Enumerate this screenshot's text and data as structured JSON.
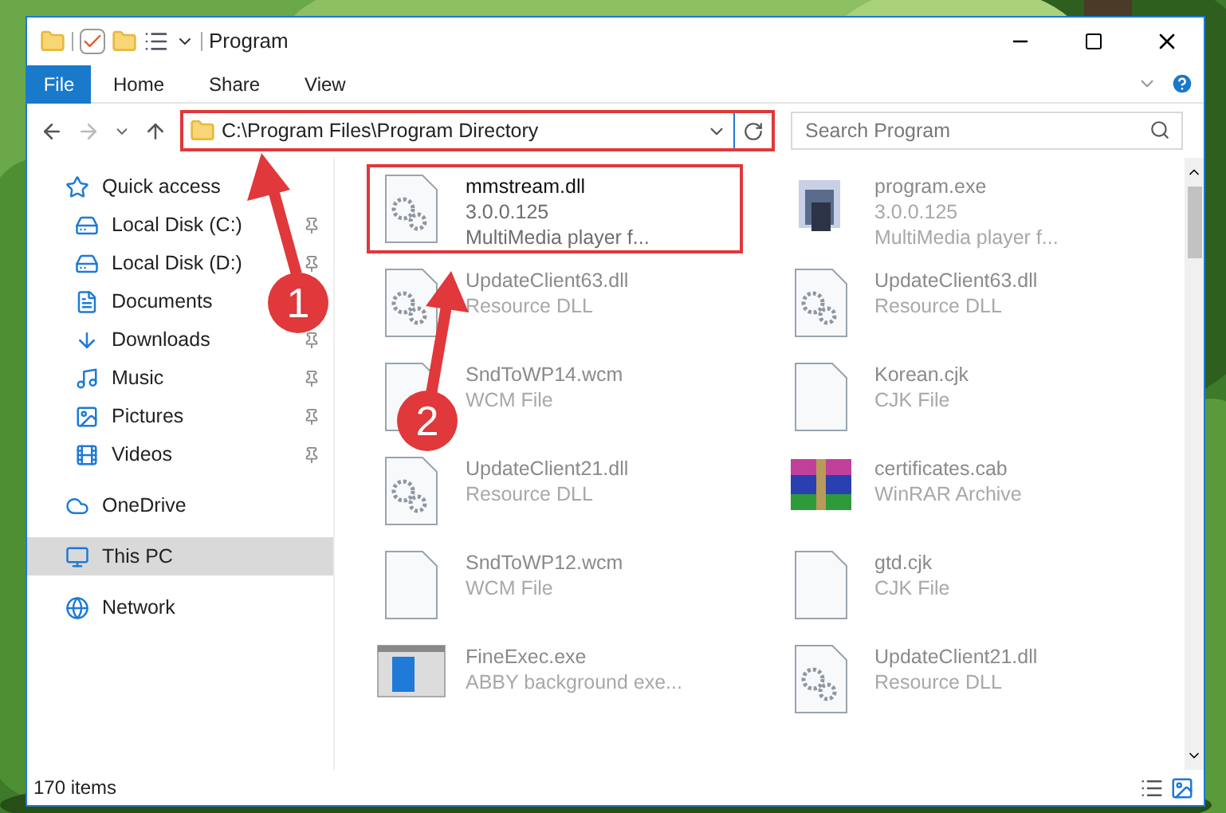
{
  "window": {
    "title": "Program"
  },
  "ribbon": {
    "tabs": [
      {
        "label": "File",
        "kind": "file"
      },
      {
        "label": "Home",
        "kind": "tab"
      },
      {
        "label": "Share",
        "kind": "tab"
      },
      {
        "label": "View",
        "kind": "tab"
      }
    ]
  },
  "address": {
    "path": "C:\\Program Files\\Program Directory",
    "highlighted": true
  },
  "search": {
    "placeholder": "Search Program"
  },
  "sidebar": {
    "items": [
      {
        "label": "Quick access",
        "selected": false,
        "children": [
          {
            "label": "Local Disk (C:)",
            "pinned": true
          },
          {
            "label": "Local Disk (D:)",
            "pinned": true
          },
          {
            "label": "Documents"
          },
          {
            "label": "Downloads",
            "pinned": true
          },
          {
            "label": "Music",
            "pinned": true
          },
          {
            "label": "Pictures",
            "pinned": true
          },
          {
            "label": "Videos",
            "pinned": true
          }
        ]
      },
      {
        "label": "OneDrive",
        "selected": false
      },
      {
        "label": "This PC",
        "selected": true
      },
      {
        "label": "Network",
        "selected": false
      }
    ]
  },
  "files": [
    {
      "name": "mmstream.dll",
      "details": [
        "3.0.0.125",
        "MultiMedia player f..."
      ],
      "kind": "dll",
      "dimmed": false,
      "highlighted": true
    },
    {
      "name": "program.exe",
      "details": [
        "3.0.0.125",
        "MultiMedia player f..."
      ],
      "kind": "exe",
      "dimmed": true,
      "highlighted": false
    },
    {
      "name": "UpdateClient63.dll",
      "details": [
        "Resource DLL"
      ],
      "kind": "dll",
      "dimmed": true,
      "highlighted": false
    },
    {
      "name": "UpdateClient63.dll",
      "details": [
        "Resource DLL"
      ],
      "kind": "dll",
      "dimmed": true,
      "highlighted": false
    },
    {
      "name": "SndToWP14.wcm",
      "details": [
        "WCM File"
      ],
      "kind": "blank",
      "dimmed": true,
      "highlighted": false
    },
    {
      "name": "Korean.cjk",
      "details": [
        "CJK File"
      ],
      "kind": "blank",
      "dimmed": true,
      "highlighted": false
    },
    {
      "name": "UpdateClient21.dll",
      "details": [
        "Resource DLL"
      ],
      "kind": "dll",
      "dimmed": true,
      "highlighted": false
    },
    {
      "name": "certificates.cab",
      "details": [
        "WinRAR Archive"
      ],
      "kind": "archive",
      "dimmed": true,
      "highlighted": false
    },
    {
      "name": "SndToWP12.wcm",
      "details": [
        "WCM File"
      ],
      "kind": "blank",
      "dimmed": true,
      "highlighted": false
    },
    {
      "name": "gtd.cjk",
      "details": [
        "CJK File"
      ],
      "kind": "blank",
      "dimmed": true,
      "highlighted": false
    },
    {
      "name": "FineExec.exe",
      "details": [
        "ABBY background exe..."
      ],
      "kind": "app",
      "dimmed": true,
      "highlighted": false
    },
    {
      "name": "UpdateClient21.dll",
      "details": [
        "Resource DLL"
      ],
      "kind": "dll",
      "dimmed": true,
      "highlighted": false
    }
  ],
  "status_bar": {
    "count": "170 items"
  },
  "annotations": [
    {
      "label": "1"
    },
    {
      "label": "2"
    }
  ]
}
